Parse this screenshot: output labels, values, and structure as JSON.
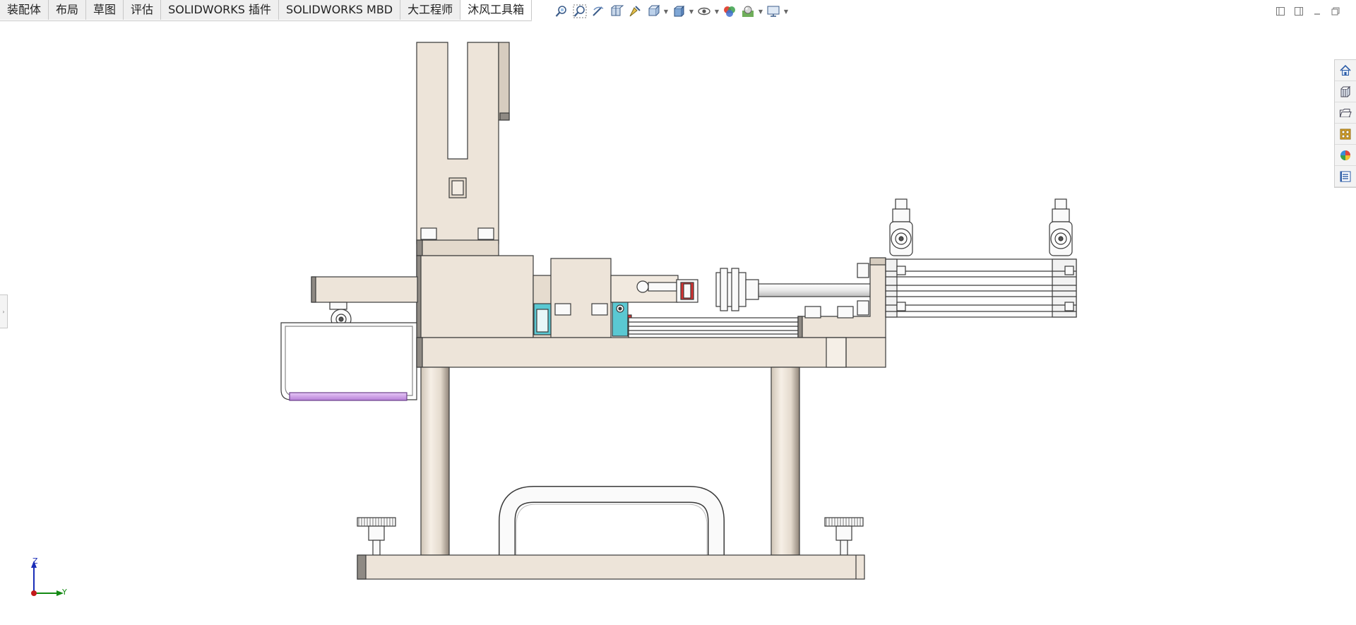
{
  "tabs": [
    {
      "label": "装配体",
      "active": false
    },
    {
      "label": "布局",
      "active": false
    },
    {
      "label": "草图",
      "active": false
    },
    {
      "label": "评估",
      "active": false
    },
    {
      "label": "SOLIDWORKS 插件",
      "active": false
    },
    {
      "label": "SOLIDWORKS MBD",
      "active": false
    },
    {
      "label": "大工程师",
      "active": false
    },
    {
      "label": "沐风工具箱",
      "active": true
    }
  ],
  "hud": [
    {
      "icon": "zoom-to-fit-icon",
      "dropdown": false
    },
    {
      "icon": "zoom-to-area-icon",
      "dropdown": false
    },
    {
      "icon": "previous-view-icon",
      "dropdown": false
    },
    {
      "icon": "section-view-icon",
      "dropdown": false
    },
    {
      "icon": "dynamic-annotation-icon",
      "dropdown": false
    },
    {
      "icon": "view-orientation-icon",
      "dropdown": true
    },
    {
      "icon": "display-style-icon",
      "dropdown": true
    },
    {
      "icon": "hide-show-items-icon",
      "dropdown": true
    },
    {
      "icon": "edit-appearance-icon",
      "dropdown": false
    },
    {
      "icon": "apply-scene-icon",
      "dropdown": true
    },
    {
      "icon": "view-settings-icon",
      "dropdown": true
    }
  ],
  "window_controls": [
    "tile-left-icon",
    "tile-right-icon",
    "minimize-icon",
    "restore-icon"
  ],
  "taskpane": [
    "home-icon",
    "design-library-icon",
    "file-explorer-icon",
    "view-palette-icon",
    "appearances-icon",
    "custom-properties-icon"
  ],
  "triad": {
    "z": "Z",
    "y": "Y"
  },
  "colors": {
    "part_fill": "#ede4d9",
    "part_stroke": "#3a3a3a",
    "part_shadow": "#8f8a84",
    "cyan_block": "#5ac8d2",
    "red_block": "#d83232",
    "handle_purple": "#d7a6ef"
  }
}
